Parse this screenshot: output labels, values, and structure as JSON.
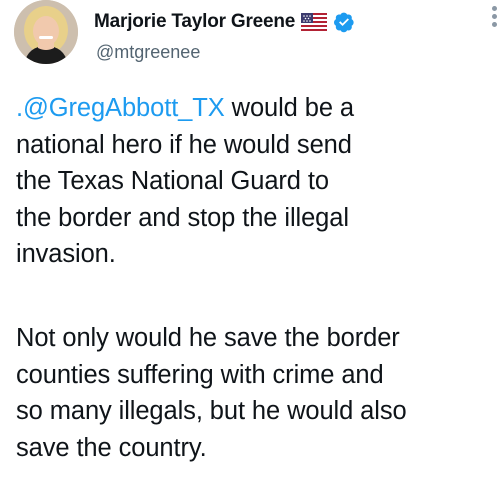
{
  "tweet": {
    "author": {
      "display_name": "Marjorie Taylor Greene",
      "handle": "@mtgreenee",
      "flag_icon": "us-flag-icon",
      "verified_icon": "verified-badge-icon"
    },
    "body": {
      "mention": ".@GregAbbott_TX",
      "line1_rest": " would be a",
      "line2": "national hero if he would send",
      "line3": "the Texas National Guard to",
      "line4": "the border and stop the illegal",
      "line5": "invasion.",
      "para2_line1": "Not only would he save the border",
      "para2_line2": "counties suffering with crime and",
      "para2_line3": "so many illegals, but he would also",
      "para2_line4": "save the country."
    },
    "colors": {
      "mention": "#1d9bf0",
      "verified": "#1d9bf0",
      "handle": "#536471"
    }
  }
}
